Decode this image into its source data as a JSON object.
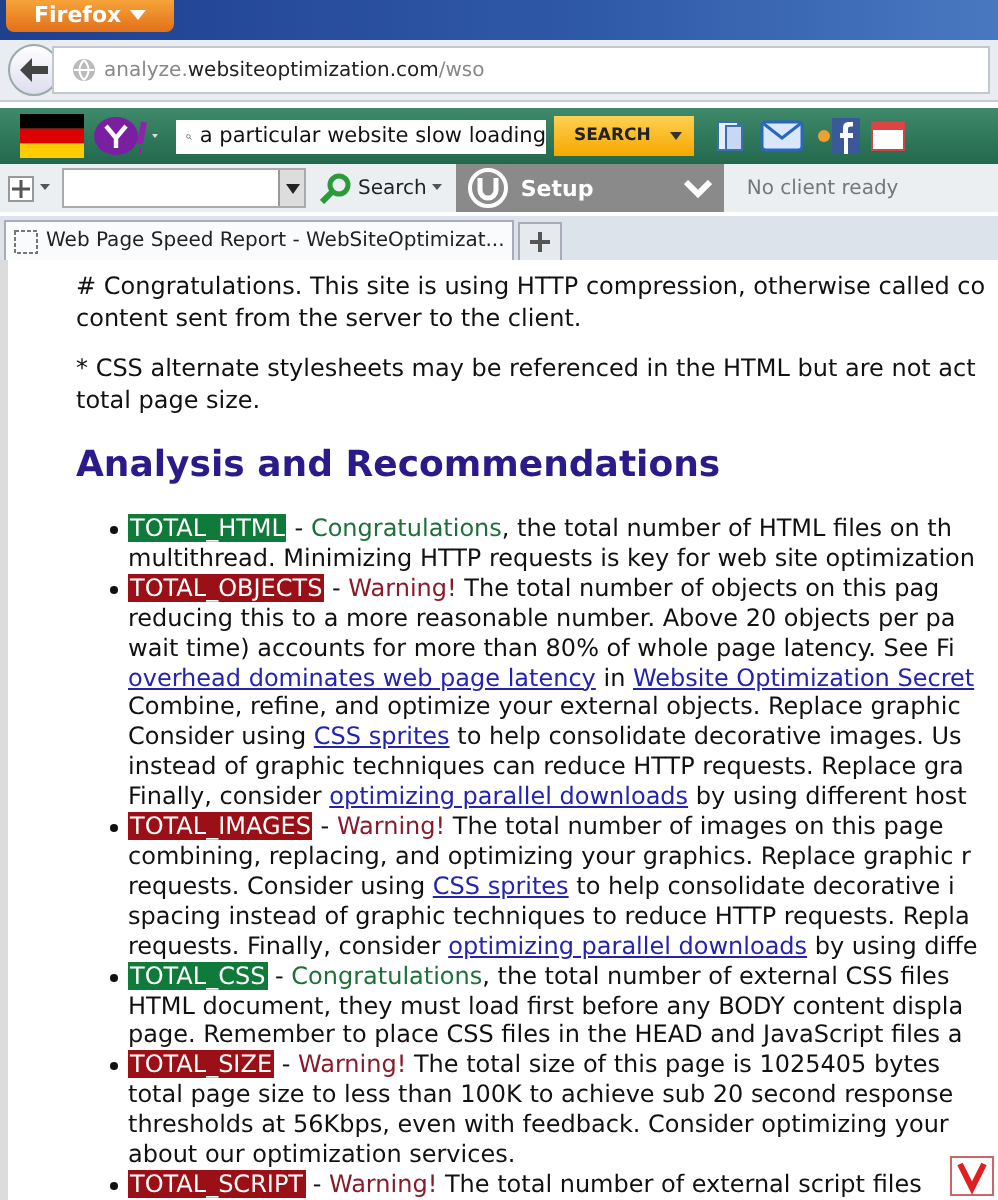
{
  "window": {
    "app_button": "Firefox"
  },
  "nav": {
    "url_host_prefix": "analyze.",
    "url_domain": "websiteoptimization.com",
    "url_path": "/wso"
  },
  "yahoo_toolbar": {
    "search_value": "a particular website slow loading",
    "search_button": "SEARCH"
  },
  "toolbar": {
    "search_label": "Search",
    "setup_label": "Setup",
    "client_status": "No client ready"
  },
  "tabs": [
    {
      "label": "Web Page Speed Report - WebSiteOptimizat...",
      "selected": true
    }
  ],
  "content": {
    "paragraphs": [
      [
        "# Congratulations. This site is using HTTP compression, otherwise called co",
        "content sent from the server to the client."
      ],
      [
        "* CSS alternate stylesheets may be referenced in the HTML but are not act",
        "total page size."
      ]
    ],
    "heading": "Analysis and Recommendations",
    "items": [
      {
        "warning": false,
        "lines": [
          [
            {
              "kind": "tag",
              "text": "TOTAL_HTML"
            },
            {
              "kind": "text",
              "text": " - "
            },
            {
              "kind": "verdict",
              "text": "Congratulations"
            },
            {
              "kind": "text",
              "text": ", the total number of HTML files on th"
            }
          ],
          [
            {
              "kind": "text",
              "text": "multithread. Minimizing HTTP requests is key for web site optimization"
            }
          ]
        ]
      },
      {
        "warning": true,
        "lines": [
          [
            {
              "kind": "tag",
              "text": "TOTAL_OBJECTS"
            },
            {
              "kind": "text",
              "text": " - "
            },
            {
              "kind": "verdict",
              "text": "Warning!"
            },
            {
              "kind": "text",
              "text": " The total number of objects on this pag"
            }
          ],
          [
            {
              "kind": "text",
              "text": "reducing this to a more reasonable number. Above 20 objects per pa"
            }
          ],
          [
            {
              "kind": "text",
              "text": "wait time) accounts for more than 80% of whole page latency. See Fi"
            }
          ],
          [
            {
              "kind": "link",
              "text": "overhead dominates web page latency"
            },
            {
              "kind": "text",
              "text": " in "
            },
            {
              "kind": "link",
              "text": "Website Optimization Secret"
            }
          ],
          [
            {
              "kind": "text",
              "text": "Combine, refine, and optimize your external objects. Replace graphic"
            }
          ],
          [
            {
              "kind": "text",
              "text": "Consider using "
            },
            {
              "kind": "link",
              "text": "CSS sprites"
            },
            {
              "kind": "text",
              "text": " to help consolidate decorative images. Us"
            }
          ],
          [
            {
              "kind": "text",
              "text": "instead of graphic techniques can reduce HTTP requests. Replace gra"
            }
          ],
          [
            {
              "kind": "text",
              "text": "Finally, consider "
            },
            {
              "kind": "link",
              "text": "optimizing parallel downloads"
            },
            {
              "kind": "text",
              "text": " by using different host"
            }
          ]
        ]
      },
      {
        "warning": true,
        "lines": [
          [
            {
              "kind": "tag",
              "text": "TOTAL_IMAGES"
            },
            {
              "kind": "text",
              "text": " - "
            },
            {
              "kind": "verdict",
              "text": "Warning!"
            },
            {
              "kind": "text",
              "text": " The total number of images on this page"
            }
          ],
          [
            {
              "kind": "text",
              "text": "combining, replacing, and optimizing your graphics. Replace graphic r"
            }
          ],
          [
            {
              "kind": "text",
              "text": "requests. Consider using "
            },
            {
              "kind": "link",
              "text": "CSS sprites"
            },
            {
              "kind": "text",
              "text": " to help consolidate decorative i"
            }
          ],
          [
            {
              "kind": "text",
              "text": "spacing instead of graphic techniques to reduce HTTP requests. Repla"
            }
          ],
          [
            {
              "kind": "text",
              "text": "requests. Finally, consider "
            },
            {
              "kind": "link",
              "text": "optimizing parallel downloads"
            },
            {
              "kind": "text",
              "text": " by using diffe"
            }
          ]
        ]
      },
      {
        "warning": false,
        "lines": [
          [
            {
              "kind": "tag",
              "text": "TOTAL_CSS"
            },
            {
              "kind": "text",
              "text": " - "
            },
            {
              "kind": "verdict",
              "text": "Congratulations"
            },
            {
              "kind": "text",
              "text": ", the total number of external CSS files"
            }
          ],
          [
            {
              "kind": "text",
              "text": "HTML document, they must load first before any BODY content displa"
            }
          ],
          [
            {
              "kind": "text",
              "text": "page. Remember to place CSS files in the HEAD and JavaScript files a"
            }
          ]
        ]
      },
      {
        "warning": true,
        "lines": [
          [
            {
              "kind": "tag",
              "text": "TOTAL_SIZE"
            },
            {
              "kind": "text",
              "text": " - "
            },
            {
              "kind": "verdict",
              "text": "Warning!"
            },
            {
              "kind": "text",
              "text": " The total size of this page is 1025405 bytes"
            }
          ],
          [
            {
              "kind": "text",
              "text": "total page size to less than 100K to achieve sub 20 second response"
            }
          ],
          [
            {
              "kind": "text",
              "text": "thresholds at 56Kbps, even with feedback. Consider optimizing your"
            }
          ],
          [
            {
              "kind": "text",
              "text": "about our optimization services."
            }
          ]
        ]
      },
      {
        "warning": true,
        "lines": [
          [
            {
              "kind": "tag",
              "text": "TOTAL_SCRIPT"
            },
            {
              "kind": "text",
              "text": " - "
            },
            {
              "kind": "verdict",
              "text": "Warning!"
            },
            {
              "kind": "text",
              "text": " The total number of external script files"
            }
          ]
        ]
      }
    ]
  }
}
